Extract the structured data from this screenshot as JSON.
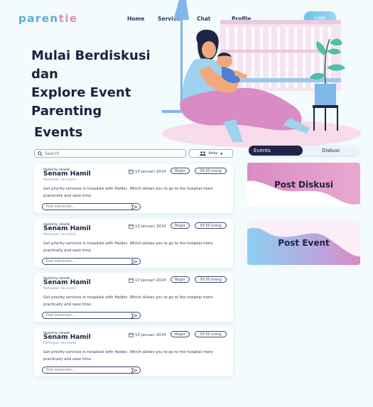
{
  "header": {
    "logo_part1": "paren",
    "logo_part2": "tie",
    "nav": [
      "Home",
      "Services",
      "Chat",
      "Profile"
    ],
    "login_label": "Login"
  },
  "hero": {
    "title": "Mulai Berdiskusi dan\nExplore Event\nParenting"
  },
  "events": {
    "heading": "Events",
    "search_placeholder": "Search",
    "filter_label": "Kota",
    "cards": [
      {
        "hosted": "Hosted by cdeadel",
        "title": "Senam Hamil",
        "subtitle": "Partisipan: ibu hamil",
        "date": "10 Januari 2024",
        "location": "Bogor",
        "capacity": "30-50 orang",
        "description": "Get priority services in hospitals with Haldoc. Which allows you to go to the hospital more practically and save time.",
        "comment_placeholder": "Post komentar..."
      },
      {
        "hosted": "Hosted by cdeadel",
        "title": "Senam Hamil",
        "subtitle": "Partisipan: ibu hamil",
        "date": "10 Januari 2024",
        "location": "Bogor",
        "capacity": "30-50 orang",
        "description": "Get priority services in hospitals with Haldoc. Which allows you to go to the hospital more practically and save time.",
        "comment_placeholder": "Post komentar..."
      },
      {
        "hosted": "Hosted by cdeadel",
        "title": "Senam Hamil",
        "subtitle": "Partisipan: ibu hamil",
        "date": "10 Januari 2024",
        "location": "Bogor",
        "capacity": "30-50 orang",
        "description": "Get priority services in hospitals with Haldoc. Which allows you to go to the hospital more practically and save time.",
        "comment_placeholder": "Post komentar..."
      },
      {
        "hosted": "Hosted by cdeadel",
        "title": "Senam Hamil",
        "subtitle": "Partisipan: ibu hamil",
        "date": "10 Januari 2024",
        "location": "Bogor",
        "capacity": "30-50 orang",
        "description": "Get priority services in hospitals with Haldoc. Which allows you to go to the hospital more practically and save time.",
        "comment_placeholder": "Post komentar..."
      }
    ]
  },
  "sidebar": {
    "tab_active": "Events",
    "tab_inactive": "Diskusi",
    "post_diskusi": "Post Diskusi",
    "post_event": "Post Event"
  },
  "colors": {
    "background": "#f3fbfd",
    "navy": "#1e2547",
    "accent_blue": "#6cc1ea",
    "accent_pink": "#d98cc3"
  },
  "icons": [
    "search-icon",
    "people-icon",
    "chevron-down-icon",
    "calendar-icon",
    "send-icon"
  ]
}
